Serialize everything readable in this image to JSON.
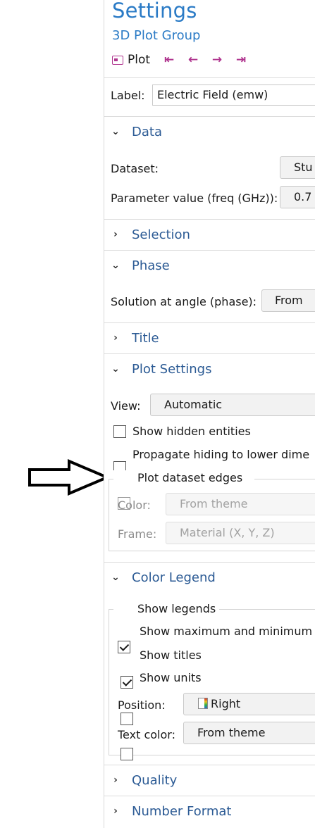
{
  "header": {
    "title": "Settings",
    "subtitle": "3D Plot Group",
    "plot_label": "Plot"
  },
  "label_row": {
    "label": "Label:",
    "value": "Electric Field (emw)"
  },
  "sections": {
    "data": {
      "title": "Data",
      "dataset_label": "Dataset:",
      "dataset_value": "Stu",
      "param_label": "Parameter value (freq (GHz)):",
      "param_value": "0.7"
    },
    "selection": {
      "title": "Selection"
    },
    "phase": {
      "title": "Phase",
      "solution_label": "Solution at angle (phase):",
      "solution_value": "From"
    },
    "title": {
      "title": "Title"
    },
    "plot_settings": {
      "title": "Plot Settings",
      "view_label": "View:",
      "view_value": "Automatic",
      "show_hidden": "Show hidden entities",
      "propagate_hiding": "Propagate hiding to lower dime",
      "plot_dataset_edges": "Plot dataset edges",
      "color_label": "Color:",
      "color_value": "From theme",
      "frame_label": "Frame:",
      "frame_value": "Material  (X, Y, Z)"
    },
    "color_legend": {
      "title": "Color Legend",
      "show_legends": "Show legends",
      "show_max_min": "Show maximum and minimum",
      "show_titles": "Show titles",
      "show_units": "Show units",
      "position_label": "Position:",
      "position_value": "Right",
      "text_color_label": "Text color:",
      "text_color_value": "From theme"
    },
    "quality": {
      "title": "Quality"
    },
    "number_format": {
      "title": "Number Format"
    }
  },
  "states": {
    "show_hidden": false,
    "propagate_hiding": false,
    "plot_dataset_edges": false,
    "show_legends": true,
    "show_max_min": true,
    "show_titles": false,
    "show_units": false
  },
  "icons": {
    "expanded": "chevron-down-icon",
    "collapsed": "chevron-right-icon",
    "nav": [
      "first-icon",
      "previous-icon",
      "next-icon",
      "last-icon"
    ]
  },
  "colors": {
    "accent": "#2b7bc6",
    "section": "#2b5a94",
    "plot_icon": "#b0358f"
  }
}
